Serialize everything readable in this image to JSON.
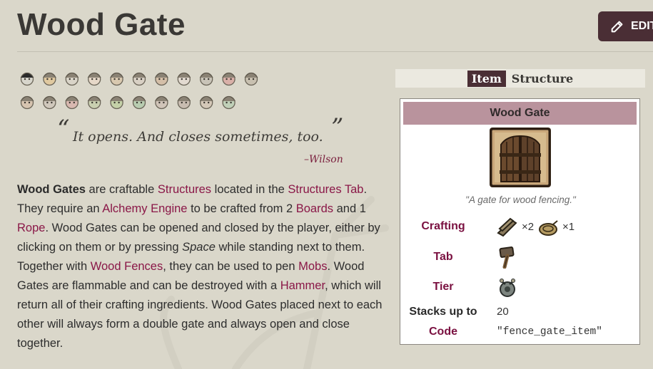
{
  "page": {
    "title": "Wood Gate",
    "edit_label": "EDIT"
  },
  "quote": {
    "open_mark": "“",
    "close_mark": "”",
    "text": "It opens. And closes sometimes, too.",
    "dash": "–",
    "author": "Wilson"
  },
  "article": {
    "p1_subject": "Wood Gates",
    "t1": " are craftable ",
    "l_structures": "Structures",
    "t2": " located in the ",
    "l_structures_tab": "Structures Tab",
    "t3": ". They require an ",
    "l_alchemy": "Alchemy Engine",
    "t4": " to be crafted from 2 ",
    "l_boards": "Boards",
    "t5": " and 1 ",
    "l_rope": "Rope",
    "t6": ". Wood Gates can be opened and closed by the player, either by clicking on them or by pressing ",
    "key": "Space",
    "t7": " while standing next to them. Together with ",
    "l_fences": "Wood Fences",
    "t8": ", they can be used to pen ",
    "l_mobs": "Mobs",
    "t9": ". Wood Gates are flammable and can be destroyed with a ",
    "l_hammer": "Hammer",
    "t10": ", which will return all of their crafting ingredients. Wood Gates placed next to each other will always form a double gate and always open and close together."
  },
  "tabs": {
    "item": "Item",
    "structure": "Structure"
  },
  "infobox": {
    "title": "Wood Gate",
    "caption": "\"A gate for wood fencing.\"",
    "rows": {
      "crafting_label": "Crafting",
      "boards_qty": "×2",
      "rope_qty": "×1",
      "tab_label": "Tab",
      "tier_label": "Tier",
      "stacks_label": "Stacks up to",
      "stacks_value": "20",
      "code_label": "Code",
      "code_value": "\"fence_gate_item\""
    }
  },
  "icons": {
    "edit": "pencil-icon",
    "characters": [
      "wilson-icon",
      "willow-icon",
      "wolfgang-icon",
      "wendy-icon",
      "wx78-icon",
      "wickerbottom-icon",
      "woodie-icon",
      "wes-icon",
      "maxwell-icon",
      "wigfrid-icon",
      "webber-icon",
      "winona-icon",
      "warly-icon",
      "walter-icon",
      "wortox-icon",
      "wormwood-icon",
      "wurt-icon",
      "wanda-icon",
      "wilba-icon",
      "walani-icon",
      "wagstaff-icon"
    ]
  },
  "colors": {
    "link": "#8a1747",
    "accent": "#4a2e35",
    "infobox_header": "#b9939d"
  }
}
